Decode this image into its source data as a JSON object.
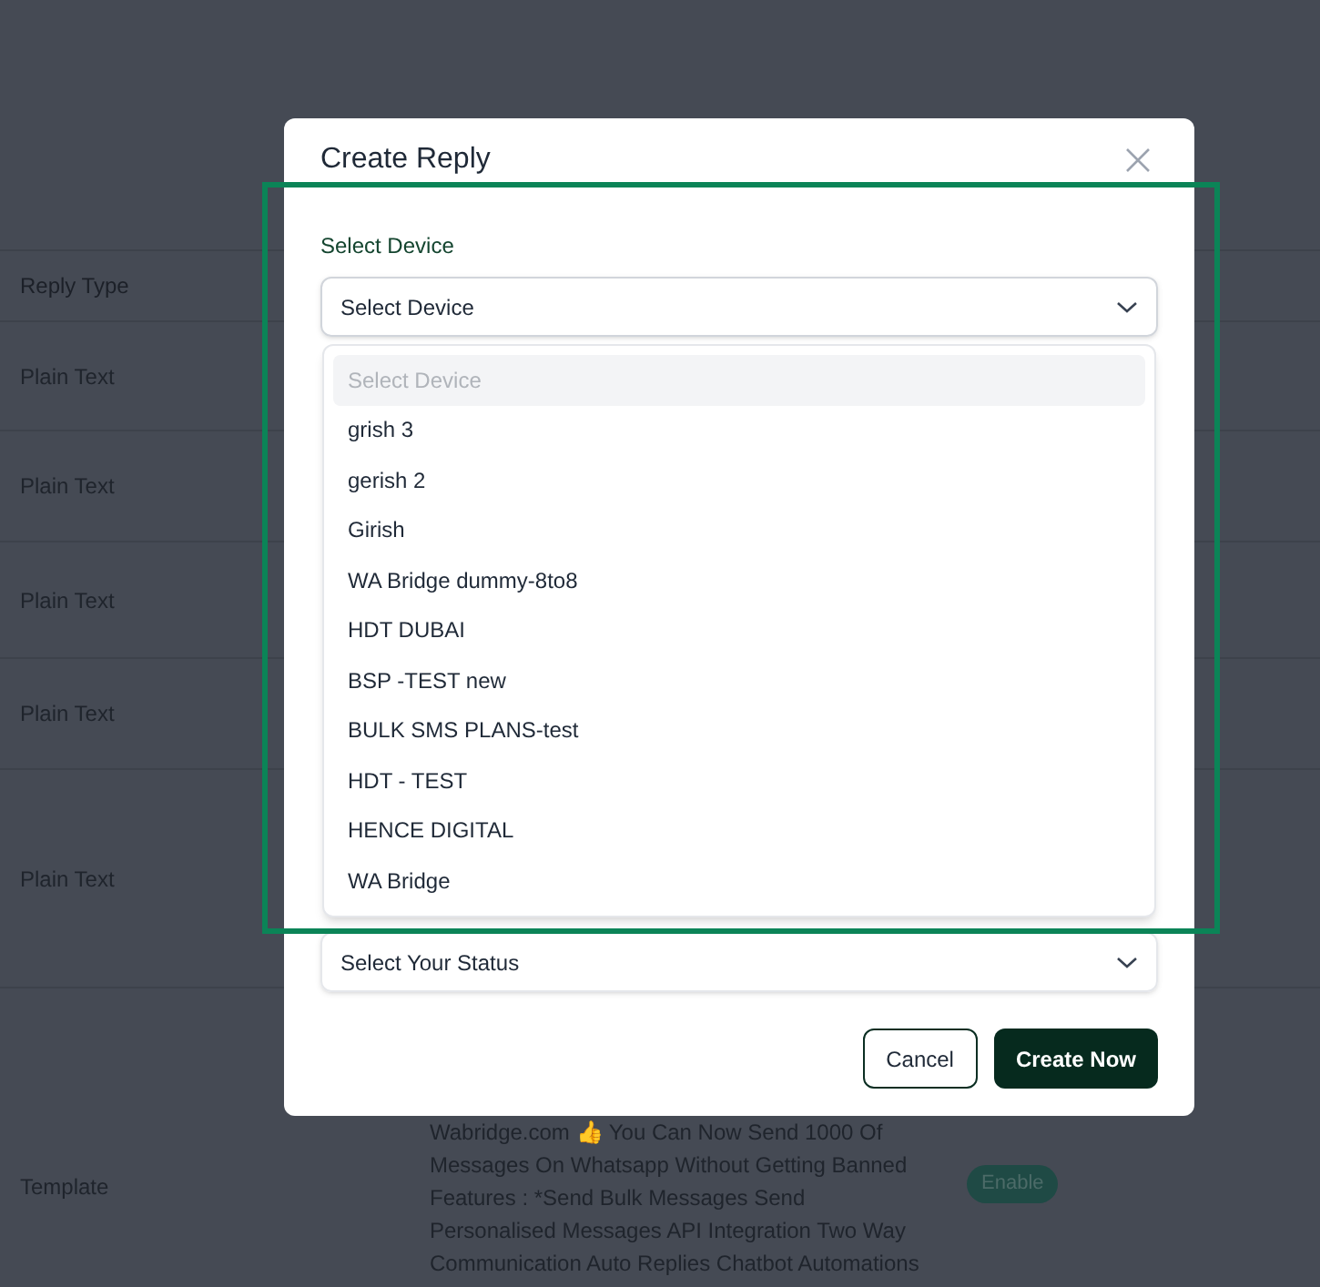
{
  "background_table": {
    "header": "Reply Type",
    "rows": [
      {
        "reply_type": "Plain Text"
      },
      {
        "reply_type": "Plain Text"
      },
      {
        "reply_type": "Plain Text"
      },
      {
        "reply_type": "Plain Text"
      },
      {
        "reply_type": "Plain Text"
      },
      {
        "reply_type": "Template",
        "message": "Wabridge.com 👍 You Can Now Send 1000 Of Messages On Whatsapp Without Getting Banned Features : *Send Bulk Messages Send Personalised Messages API Integration Two Way Communication Auto Replies Chatbot Automations",
        "status": "Enable"
      }
    ]
  },
  "dialog": {
    "title": "Create Reply",
    "device_label": "Select Device",
    "device_select": {
      "value": "Select Device",
      "expanded": true
    },
    "device_options": [
      {
        "label": "Select Device",
        "disabled": true,
        "selected": true
      },
      {
        "label": "grish 3",
        "disabled": false,
        "selected": false
      },
      {
        "label": "gerish 2",
        "disabled": false,
        "selected": false
      },
      {
        "label": "Girish",
        "disabled": false,
        "selected": false
      },
      {
        "label": "WA Bridge dummy-8to8",
        "disabled": false,
        "selected": false
      },
      {
        "label": "HDT DUBAI",
        "disabled": false,
        "selected": false
      },
      {
        "label": "BSP -TEST new",
        "disabled": false,
        "selected": false
      },
      {
        "label": "BULK SMS PLANS-test",
        "disabled": false,
        "selected": false
      },
      {
        "label": "HDT - TEST",
        "disabled": false,
        "selected": false
      },
      {
        "label": "HENCE DIGITAL",
        "disabled": false,
        "selected": false
      },
      {
        "label": "WA Bridge",
        "disabled": false,
        "selected": false
      }
    ],
    "status_select": {
      "value": "Select Your Status"
    },
    "buttons": [
      {
        "label": "Cancel",
        "kind": "secondary"
      },
      {
        "label": "Create Now",
        "kind": "primary"
      }
    ]
  }
}
